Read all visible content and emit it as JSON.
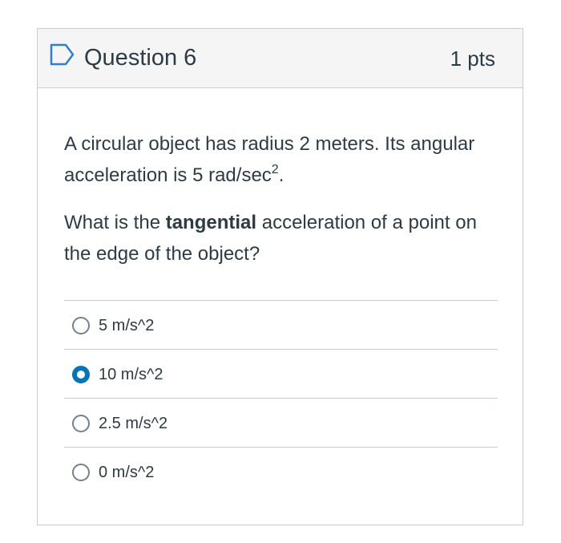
{
  "question": {
    "name": "Question 6",
    "points": "1 pts",
    "flag_icon": "bookmark-flag-icon",
    "text": {
      "paragraph1_main": "A circular object has radius 2 meters. Its angular acceleration is 5 rad/sec",
      "paragraph1_superscript": "2",
      "paragraph1_end": ".",
      "paragraph2_before": "What is the ",
      "paragraph2_bold": "tangential",
      "paragraph2_after": " acceleration of a point on the edge of the object?"
    },
    "answers": [
      {
        "label": "5 m/s^2",
        "selected": false
      },
      {
        "label": "10 m/s^2",
        "selected": true
      },
      {
        "label": "2.5 m/s^2",
        "selected": false
      },
      {
        "label": "0 m/s^2",
        "selected": false
      }
    ]
  },
  "colors": {
    "text": "#2d3b45",
    "border": "#c7cdd1",
    "header_background": "#f5f5f5",
    "radio_selected": "#0374b5",
    "radio_unselected_border": "#73818c",
    "flag": "#2d7fd1"
  }
}
